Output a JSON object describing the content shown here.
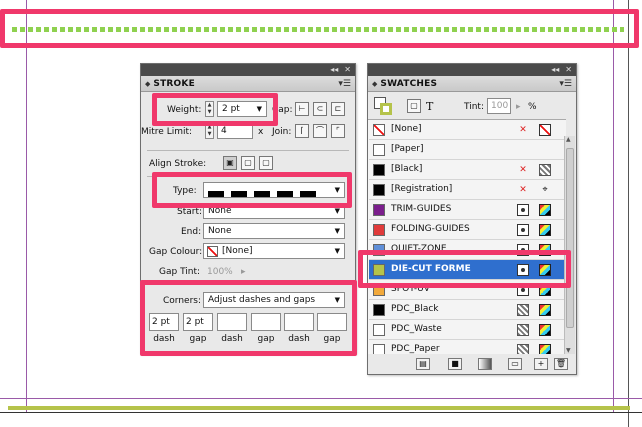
{
  "stroke": {
    "title": "STROKE",
    "weight_label": "Weight:",
    "weight_value": "2 pt",
    "cap_label": "Cap:",
    "mitre_label": "Mitre Limit:",
    "mitre_value": "4",
    "mitre_unit": "x",
    "join_label": "Join:",
    "align_label": "Align Stroke:",
    "type_label": "Type:",
    "start_label": "Start:",
    "start_value": "None",
    "end_label": "End:",
    "end_value": "None",
    "gap_colour_label": "Gap Colour:",
    "gap_colour_value": "[None]",
    "gap_tint_label": "Gap Tint:",
    "gap_tint_value": "100%",
    "corners_label": "Corners:",
    "corners_value": "Adjust dashes and gaps",
    "dash_gap": [
      {
        "value": "2 pt",
        "label": "dash"
      },
      {
        "value": "2 pt",
        "label": "gap"
      },
      {
        "value": "",
        "label": "dash"
      },
      {
        "value": "",
        "label": "gap"
      },
      {
        "value": "",
        "label": "dash"
      },
      {
        "value": "",
        "label": "gap"
      }
    ]
  },
  "swatches": {
    "title": "SWATCHES",
    "tint_label": "Tint:",
    "tint_value": "100",
    "tint_unit": "%",
    "text_icon": "T",
    "items": [
      {
        "name": "[None]",
        "color": "none"
      },
      {
        "name": "[Paper]",
        "color": "#ffffff"
      },
      {
        "name": "[Black]",
        "color": "#000000"
      },
      {
        "name": "[Registration]",
        "color": "#000000"
      },
      {
        "name": "TRIM-GUIDES",
        "color": "#7b1e8c"
      },
      {
        "name": "FOLDING-GUIDES",
        "color": "#e03a3a"
      },
      {
        "name": "QUIET-ZONE",
        "color": "#5f8fd8"
      },
      {
        "name": "DIE-CUT FORME",
        "color": "#b5c34a"
      },
      {
        "name": "SPOT-UV",
        "color": "#f2a93b"
      },
      {
        "name": "PDC_Black",
        "color": "#000000"
      },
      {
        "name": "PDC_Waste",
        "color": "#ffffff"
      },
      {
        "name": "PDC_Paper",
        "color": "#ffffff"
      }
    ]
  },
  "colors": {
    "highlight": "#f0386b",
    "selection": "#2f6fce",
    "dotted_stroke": "#8fd14f",
    "olive_stroke": "#b5c34a"
  }
}
